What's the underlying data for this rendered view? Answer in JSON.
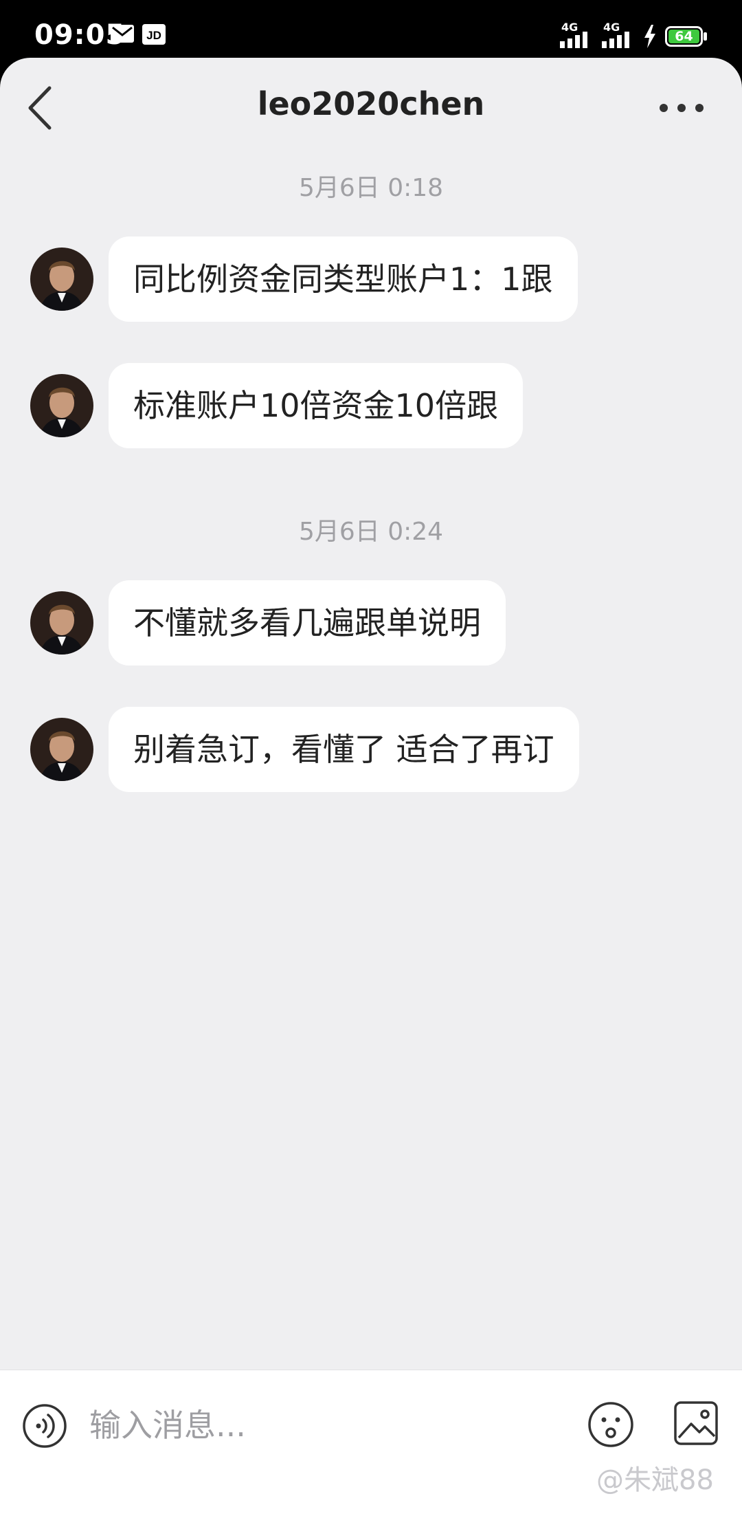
{
  "status_bar": {
    "time": "09:05",
    "battery_level": "64",
    "network_1": "4G",
    "network_2": "4G"
  },
  "header": {
    "title": "leo2020chen"
  },
  "chat": {
    "timestamps": [
      "5月6日 0:18",
      "5月6日 0:24"
    ],
    "messages": [
      {
        "text": "同比例资金同类型账户1：1跟"
      },
      {
        "text": "标准账户10倍资金10倍跟"
      },
      {
        "text": "不懂就多看几遍跟单说明"
      },
      {
        "text": "别着急订，看懂了 适合了再订"
      }
    ]
  },
  "input_bar": {
    "placeholder": "输入消息..."
  },
  "watermark": "@朱斌88",
  "colors": {
    "background": "#efeff1",
    "bubble": "#ffffff",
    "timestamp": "#a0a0a4",
    "battery": "#3ec93e"
  }
}
